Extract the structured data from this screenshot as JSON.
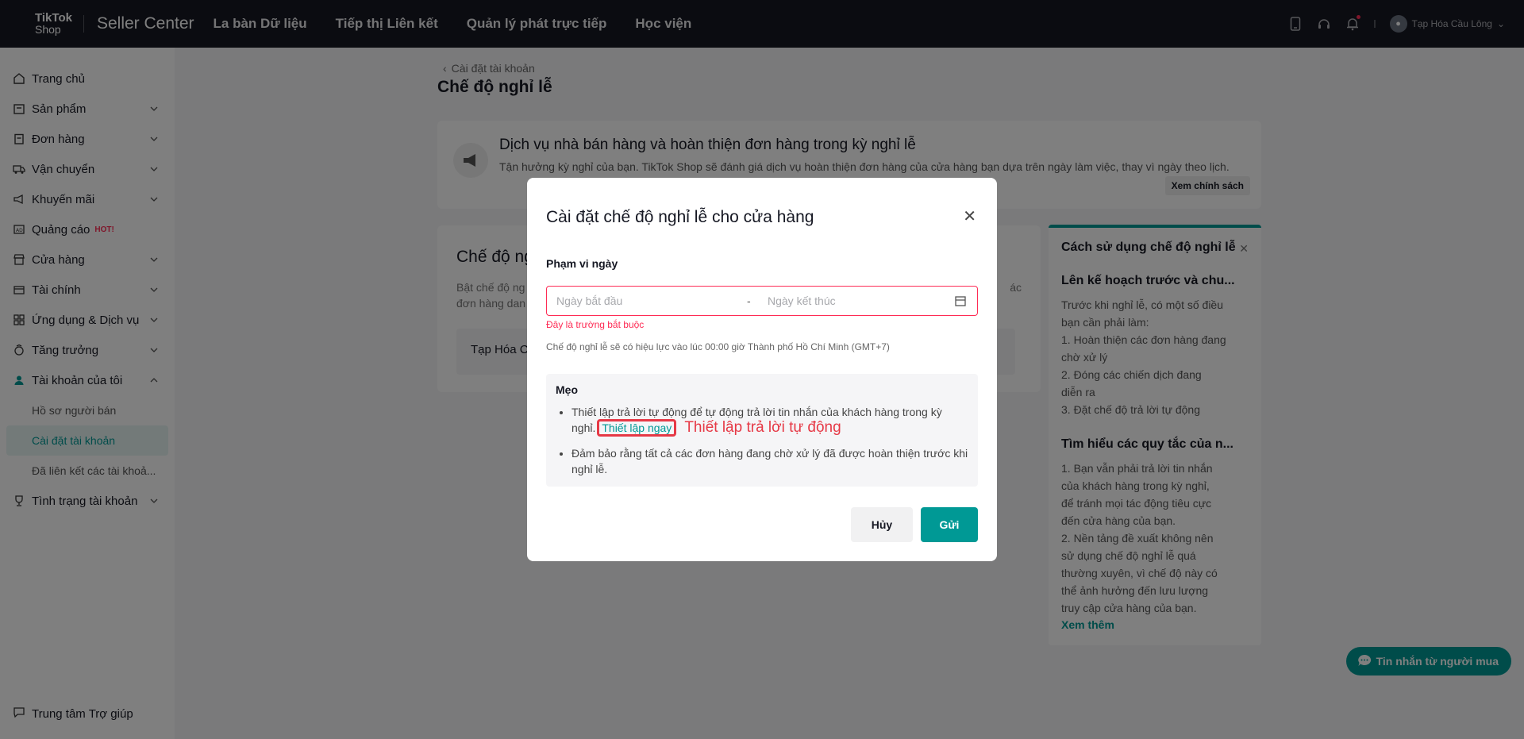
{
  "topbar": {
    "logo_line1": "TikTok",
    "logo_line2": "Shop",
    "app_title": "Seller Center",
    "nav": [
      "La bàn Dữ liệu",
      "Tiếp thị Liên kết",
      "Quản lý phát trực tiếp",
      "Học viện"
    ],
    "user_name": "Tạp Hóa Cầu Lông",
    "icons": [
      "phone-icon",
      "headset-icon",
      "bell-icon"
    ]
  },
  "sidebar": {
    "items": [
      {
        "label": "Trang chủ",
        "icon": "home-icon",
        "chevron": false
      },
      {
        "label": "Sản phẩm",
        "icon": "box-icon",
        "chevron": true
      },
      {
        "label": "Đơn hàng",
        "icon": "clipboard-icon",
        "chevron": true
      },
      {
        "label": "Vận chuyển",
        "icon": "truck-icon",
        "chevron": true
      },
      {
        "label": "Khuyến mãi",
        "icon": "megaphone-icon",
        "chevron": true
      },
      {
        "label": "Quảng cáo",
        "icon": "ad-icon",
        "chevron": false,
        "badge": "HOT!"
      },
      {
        "label": "Cửa hàng",
        "icon": "store-icon",
        "chevron": true
      },
      {
        "label": "Tài chính",
        "icon": "wallet-icon",
        "chevron": true
      },
      {
        "label": "Ứng dụng & Dịch vụ",
        "icon": "apps-icon",
        "chevron": true
      },
      {
        "label": "Tăng trưởng",
        "icon": "growth-icon",
        "chevron": true
      },
      {
        "label": "Tài khoản của tôi",
        "icon": "user-icon",
        "chevron": true,
        "expanded": true
      }
    ],
    "sub_items": [
      "Hồ sơ người bán",
      "Cài đặt tài khoản",
      "Đã liên kết các tài khoả..."
    ],
    "last_item": "Tình trạng tài khoản",
    "help": "Trung tâm Trợ giúp"
  },
  "page": {
    "breadcrumb": "Cài đặt tài khoản",
    "title": "Chế độ nghỉ lễ",
    "banner_title": "Dịch vụ nhà bán hàng và hoàn thiện đơn hàng trong kỳ nghỉ lễ",
    "banner_sub": "Tận hưởng kỳ nghỉ của bạn. TikTok Shop sẽ đánh giá dịch vụ hoàn thiện đơn hàng của cửa hàng bạn dựa trên ngày làm việc, thay vì ngày theo lịch.",
    "banner_btn": "Xem chính sách",
    "card_title": "Chế độ ng",
    "card_text_l1": "Bật chế độ ng",
    "card_text_l2": "đơn hàng dan",
    "card_text_r": "ác",
    "store_name": "Tạp Hóa C",
    "chat_btn": "Tin nhắn từ người mua"
  },
  "tips_panel": {
    "title": "Cách sử dụng chế độ nghỉ lễ",
    "h1": "Lên kế hoạch trước và chu...",
    "p1": [
      "Trước khi nghỉ lễ, có một số điều",
      "bạn cần phải làm:",
      "1. Hoàn thiện các đơn hàng đang",
      "chờ xử lý",
      "2. Đóng các chiến dịch đang",
      "diễn ra",
      "3. Đặt chế độ trả lời tự động"
    ],
    "h2": "Tìm hiểu các quy tắc của n...",
    "p2": [
      "1. Bạn vẫn phải trả lời tin nhắn",
      "của khách hàng trong kỳ nghỉ,",
      "để tránh mọi tác động tiêu cực",
      "đến cửa hàng của bạn.",
      "2. Nền tảng đề xuất không nên",
      "sử dụng chế độ nghỉ lễ quá",
      "thường xuyên, vì chế độ này có",
      "thể ảnh hưởng đến lưu lượng",
      "truy cập cửa hàng của bạn."
    ],
    "more": "Xem thêm"
  },
  "modal": {
    "title": "Cài đặt chế độ nghỉ lễ cho cửa hàng",
    "field_label": "Phạm vi ngày",
    "start_placeholder": "Ngày bắt đầu",
    "end_placeholder": "Ngày kết thúc",
    "dash": "-",
    "error": "Đây là trường bắt buộc",
    "note": "Chế độ nghỉ lễ sẽ có hiệu lực vào lúc 00:00 giờ Thành phố Hồ Chí Minh (GMT+7)",
    "tips_title": "Mẹo",
    "tip1": "Thiết lập trả lời tự động để tự động trả lời tin nhắn của khách hàng trong kỳ nghỉ.",
    "tip1_link": "Thiết lập ngay",
    "annotation": "Thiết lập trả lời tự động",
    "tip2": "Đảm bảo rằng tất cả các đơn hàng đang chờ xử lý đã được hoàn thiện trước khi nghỉ lễ.",
    "cancel": "Hủy",
    "submit": "Gửi"
  },
  "colors": {
    "accent": "#009995",
    "error": "#fe2c55",
    "annotation": "#e63946",
    "topbar": "#161823"
  }
}
